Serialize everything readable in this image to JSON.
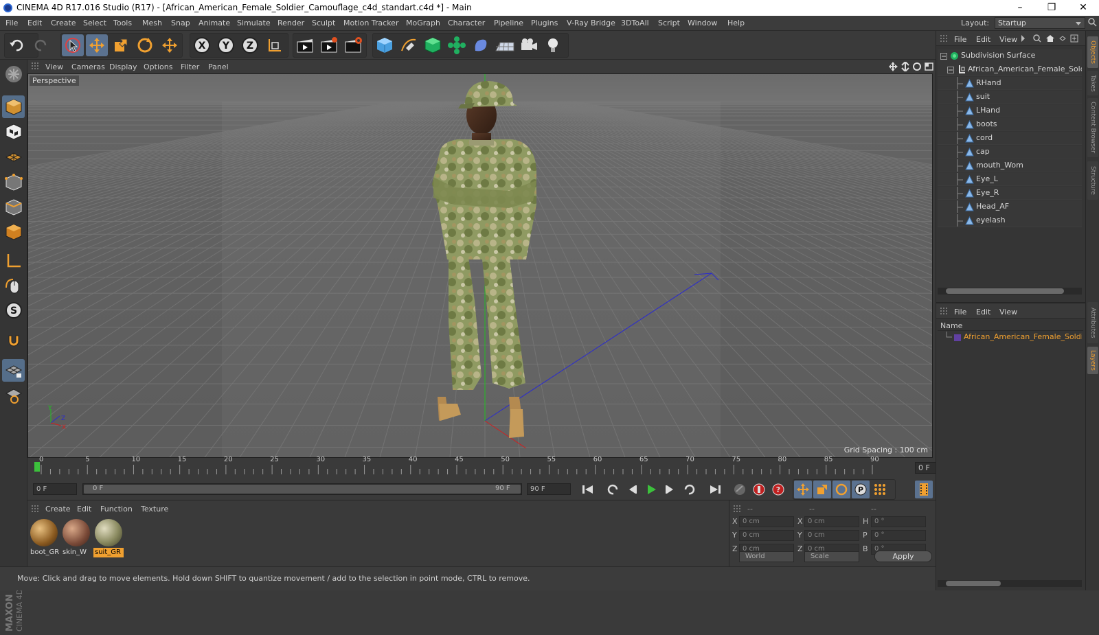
{
  "window": {
    "title": "CINEMA 4D R17.016 Studio (R17) - [African_American_Female_Soldier_Camouflage_c4d_standart.c4d *] - Main",
    "minimize": "–",
    "maximize": "❐",
    "close": "✕"
  },
  "menubar": {
    "items": [
      "File",
      "Edit",
      "Create",
      "Select",
      "Tools",
      "Mesh",
      "Snap",
      "Animate",
      "Simulate",
      "Render",
      "Sculpt",
      "Motion Tracker",
      "MoGraph",
      "Character",
      "Pipeline",
      "Plugins",
      "V-Ray Bridge",
      "3DToAll",
      "Script",
      "Window",
      "Help"
    ],
    "layout_label": "Layout:",
    "layout_value": "Startup"
  },
  "viewport": {
    "menu": [
      "View",
      "Cameras",
      "Display",
      "Options",
      "Filter",
      "Panel"
    ],
    "camera_label": "Perspective",
    "grid_spacing": "Grid Spacing : 100 cm",
    "axis": {
      "y": "Y",
      "z": "Z",
      "x": "X"
    }
  },
  "timeline": {
    "ticks": [
      "0",
      "5",
      "10",
      "15",
      "20",
      "25",
      "30",
      "35",
      "40",
      "45",
      "50",
      "55",
      "60",
      "65",
      "70",
      "75",
      "80",
      "85",
      "90"
    ],
    "current_frame_field": "0 F",
    "start_field": "0 F",
    "range_start": "0 F",
    "range_end": "90 F",
    "end_field": "90 F"
  },
  "materials": {
    "menu": [
      "Create",
      "Edit",
      "Function",
      "Texture"
    ],
    "items": [
      {
        "name": "boot_GR",
        "active": false
      },
      {
        "name": "skin_W",
        "active": false
      },
      {
        "name": "suit_GR",
        "active": true
      }
    ]
  },
  "coordinates": {
    "headers": [
      "--",
      "--",
      "--"
    ],
    "rows": [
      {
        "l1": "X",
        "v1": "0 cm",
        "l2": "X",
        "v2": "0 cm",
        "l3": "H",
        "v3": "0 °"
      },
      {
        "l1": "Y",
        "v1": "0 cm",
        "l2": "Y",
        "v2": "0 cm",
        "l3": "P",
        "v3": "0 °"
      },
      {
        "l1": "Z",
        "v1": "0 cm",
        "l2": "Z",
        "v2": "0 cm",
        "l3": "B",
        "v3": "0 °"
      }
    ],
    "mode1": "World",
    "mode2": "Scale",
    "apply": "Apply"
  },
  "status": {
    "text": "Move: Click and drag to move elements. Hold down SHIFT to quantize movement / add to the selection in point mode, CTRL to remove."
  },
  "objects_panel": {
    "menu": [
      "File",
      "Edit",
      "View"
    ],
    "root": "Subdivision Surface",
    "group": "African_American_Female_Soldie",
    "children": [
      "RHand",
      "suit",
      "LHand",
      "boots",
      "cord",
      "cap",
      "mouth_Wom",
      "Eye_L",
      "Eye_R",
      "Head_AF",
      "eyelash"
    ]
  },
  "layers_panel": {
    "menu": [
      "File",
      "Edit",
      "View"
    ],
    "column": "Name",
    "layer": "African_American_Female_Soldier_"
  },
  "side_tabs": [
    "Objects",
    "Takes",
    "Content Browser",
    "Structure",
    "Attributes",
    "Layers"
  ],
  "colors": {
    "accent_orange": "#f0a030",
    "selection_blue": "#5b7290",
    "play_green": "#3cc03c",
    "axis_blue": "#2a2ad0",
    "axis_green": "#20c020",
    "axis_red": "#d02020"
  }
}
